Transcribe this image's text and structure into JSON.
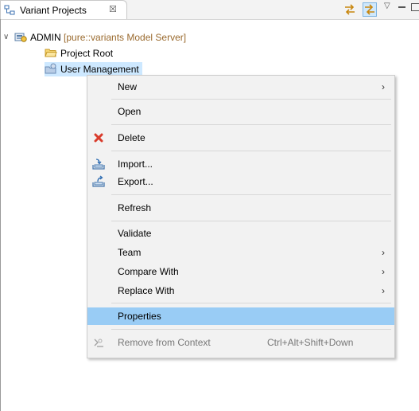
{
  "view": {
    "tab_title": "Variant Projects",
    "tab_close_glyph": "☒",
    "icons": [
      "variant-projects-icon",
      "sync-icon",
      "link-with-editor-icon",
      "view-menu-icon",
      "minimize-icon",
      "maximize-icon"
    ]
  },
  "tree": {
    "admin": {
      "expander": "∨",
      "label": "ADMIN",
      "server": "[pure::variants Model Server]"
    },
    "project_root": {
      "label": "Project Root"
    },
    "user_management": {
      "label": "User Management"
    }
  },
  "menu": {
    "new": {
      "label": "New",
      "arrow": "›"
    },
    "open": {
      "label": "Open"
    },
    "delete": {
      "label": "Delete"
    },
    "import": {
      "label": "Import..."
    },
    "export": {
      "label": "Export..."
    },
    "refresh": {
      "label": "Refresh"
    },
    "validate": {
      "label": "Validate"
    },
    "team": {
      "label": "Team",
      "arrow": "›"
    },
    "compare": {
      "label": "Compare With",
      "arrow": "›"
    },
    "replace": {
      "label": "Replace With",
      "arrow": "›"
    },
    "properties": {
      "label": "Properties"
    },
    "remove": {
      "label": "Remove from Context",
      "shortcut": "Ctrl+Alt+Shift+Down"
    }
  },
  "colors": {
    "menu_highlight": "#99ccf5",
    "selection": "#cde8ff",
    "server_text": "#9a6a2e",
    "delete_icon": "#d93b2b"
  }
}
